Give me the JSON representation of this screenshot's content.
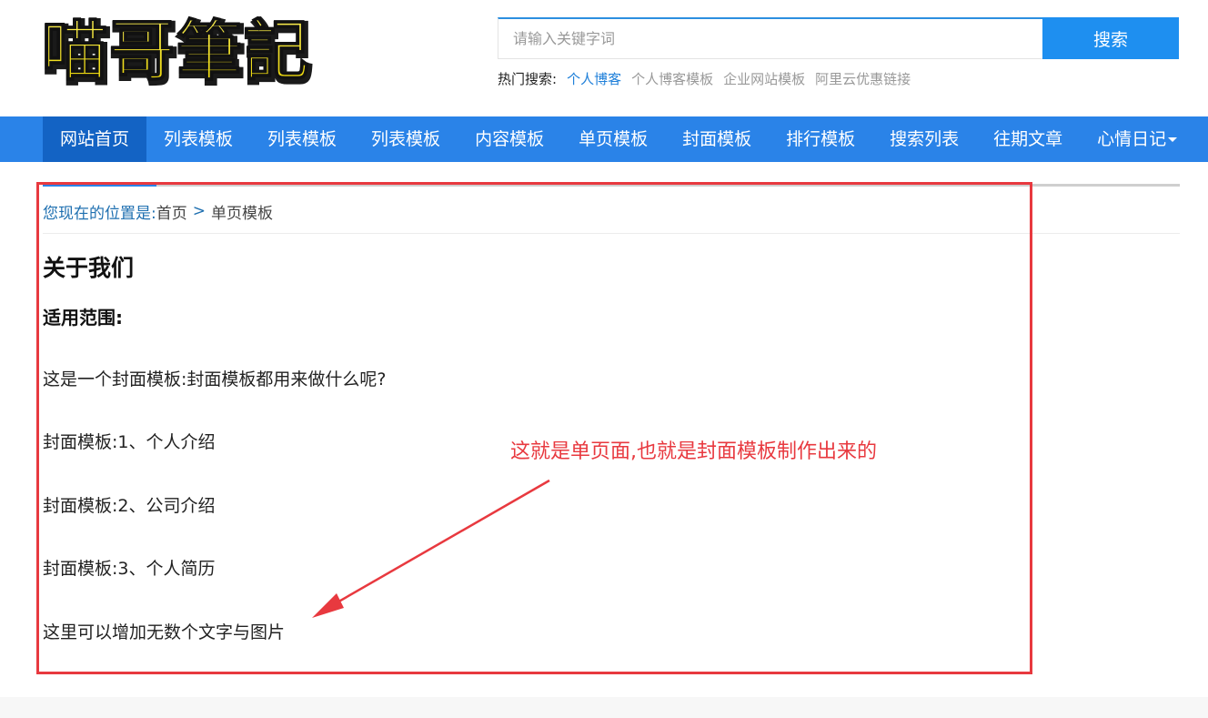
{
  "header": {
    "logo_text": "喵哥筆記",
    "search": {
      "placeholder": "请输入关键字词",
      "button_label": "搜索"
    },
    "hot_search": {
      "label": "热门搜索:",
      "links": [
        "个人博客",
        "个人博客模板",
        "企业网站模板",
        "阿里云优惠链接"
      ]
    }
  },
  "nav": {
    "items": [
      "网站首页",
      "列表模板",
      "列表模板",
      "列表模板",
      "内容模板",
      "单页模板",
      "封面模板",
      "排行模板",
      "搜索列表",
      "往期文章",
      "心情日记"
    ],
    "active_index": 0
  },
  "breadcrumb": {
    "label": "您现在的位置是:",
    "home": "首页",
    "separator": ">",
    "current": "单页模板"
  },
  "article": {
    "title": "关于我们",
    "section_title": "适用范围:",
    "paragraphs": [
      "这是一个封面模板:封面模板都用来做什么呢?",
      "封面模板:1、个人介绍",
      "封面模板:2、公司介绍",
      "封面模板:3、个人简历",
      "这里可以增加无数个文字与图片"
    ]
  },
  "annotation": {
    "text": "这就是单页面,也就是封面模板制作出来的",
    "color": "#e8393f"
  },
  "colors": {
    "nav_bg": "#2a83e8",
    "nav_active_bg": "#1363c4",
    "search_button_bg": "#1e8ff0",
    "link_blue": "#1e7fd9"
  }
}
